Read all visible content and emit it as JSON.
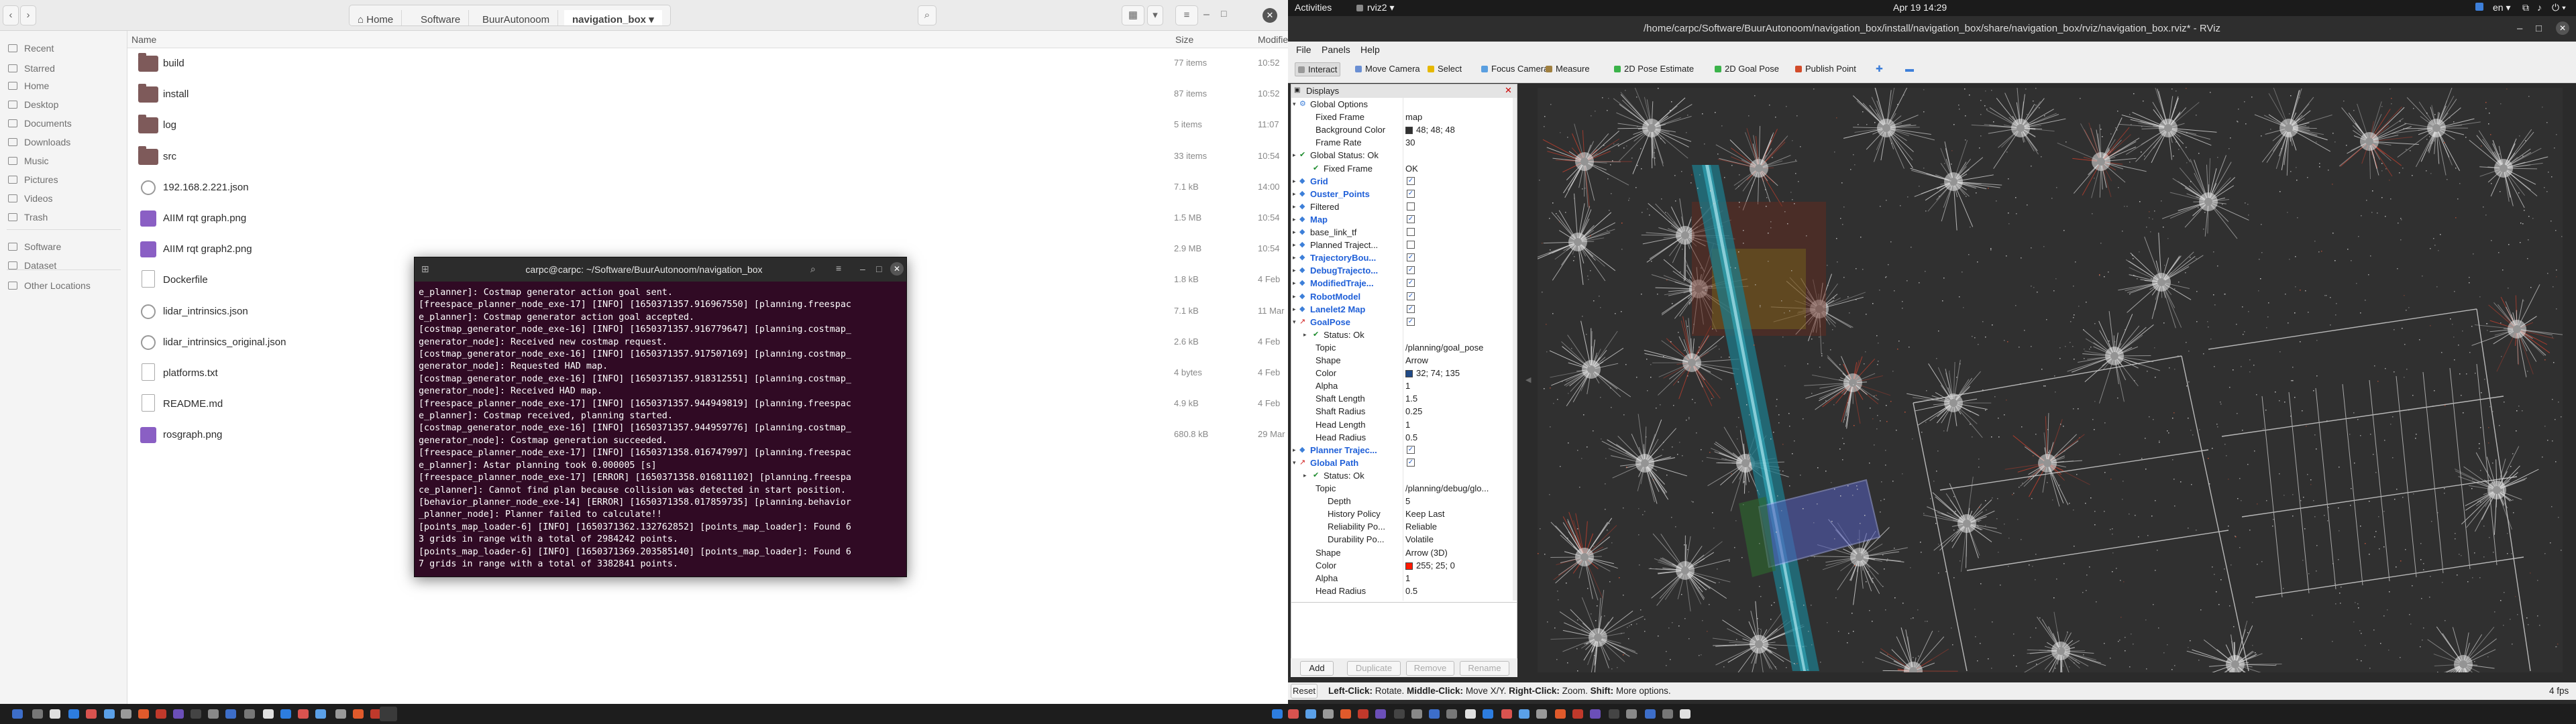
{
  "file_manager": {
    "path": [
      "Home",
      "Software",
      "BuurAutonoom",
      "navigation_box"
    ],
    "columns": {
      "name": "Name",
      "size": "Size",
      "modified": "Modified"
    },
    "sidebar": [
      {
        "label": "Recent",
        "icon": "clock-icon"
      },
      {
        "label": "Starred",
        "icon": "star-icon"
      },
      {
        "label": "Home",
        "icon": "home-icon"
      },
      {
        "label": "Desktop",
        "icon": "folder-icon"
      },
      {
        "label": "Documents",
        "icon": "folder-icon"
      },
      {
        "label": "Downloads",
        "icon": "download-icon"
      },
      {
        "label": "Music",
        "icon": "music-icon"
      },
      {
        "label": "Pictures",
        "icon": "image-icon"
      },
      {
        "label": "Videos",
        "icon": "video-icon"
      },
      {
        "label": "Trash",
        "icon": "trash-icon"
      },
      {
        "label": "Software",
        "icon": "folder-icon"
      },
      {
        "label": "Dataset",
        "icon": "folder-icon"
      },
      {
        "label": "Other Locations",
        "icon": "plus-icon"
      }
    ],
    "files": [
      {
        "name": "build",
        "size": "77 items",
        "modified": "10:52",
        "type": "folder"
      },
      {
        "name": "install",
        "size": "87 items",
        "modified": "10:52",
        "type": "folder"
      },
      {
        "name": "log",
        "size": "5 items",
        "modified": "11:07",
        "type": "folder"
      },
      {
        "name": "src",
        "size": "33 items",
        "modified": "10:54",
        "type": "folder"
      },
      {
        "name": "192.168.2.221.json",
        "size": "7.1 kB",
        "modified": "14:00",
        "type": "json"
      },
      {
        "name": "AIIM rqt graph.png",
        "size": "1.5 MB",
        "modified": "10:54",
        "type": "image"
      },
      {
        "name": "AIIM rqt graph2.png",
        "size": "2.9 MB",
        "modified": "10:54",
        "type": "image"
      },
      {
        "name": "Dockerfile",
        "size": "1.8 kB",
        "modified": "4 Feb",
        "type": "text"
      },
      {
        "name": "lidar_intrinsics.json",
        "size": "7.1 kB",
        "modified": "11 Mar",
        "type": "json"
      },
      {
        "name": "lidar_intrinsics_original.json",
        "size": "2.6 kB",
        "modified": "4 Feb",
        "type": "json"
      },
      {
        "name": "platforms.txt",
        "size": "4 bytes",
        "modified": "4 Feb",
        "type": "text"
      },
      {
        "name": "README.md",
        "size": "4.9 kB",
        "modified": "4 Feb",
        "type": "text"
      },
      {
        "name": "rosgraph.png",
        "size": "680.8 kB",
        "modified": "29 Mar",
        "type": "image"
      }
    ]
  },
  "terminal": {
    "title": "carpc@carpc: ~/Software/BuurAutonoom/navigation_box",
    "lines": [
      "e_planner]: Costmap generator action goal sent.",
      "[freespace_planner_node_exe-17] [INFO] [1650371357.916967550] [planning.freespac",
      "e_planner]: Costmap generator action goal accepted.",
      "[costmap_generator_node_exe-16] [INFO] [1650371357.916779647] [planning.costmap_",
      "generator_node]: Received new costmap request.",
      "[costmap_generator_node_exe-16] [INFO] [1650371357.917507169] [planning.costmap_",
      "generator_node]: Requested HAD map.",
      "[costmap_generator_node_exe-16] [INFO] [1650371357.918312551] [planning.costmap_",
      "generator_node]: Received HAD map.",
      "[freespace_planner_node_exe-17] [INFO] [1650371357.944949819] [planning.freespac",
      "e_planner]: Costmap received, planning started.",
      "[costmap_generator_node_exe-16] [INFO] [1650371357.944959776] [planning.costmap_",
      "generator_node]: Costmap generation succeeded.",
      "[freespace_planner_node_exe-17] [INFO] [1650371358.016747997] [planning.freespac",
      "e_planner]: Astar planning took 0.000005 [s]",
      "[freespace_planner_node_exe-17] [ERROR] [1650371358.016811102] [planning.freespa",
      "ce_planner]: Cannot find plan because collision was detected in start position.",
      "[behavior_planner_node_exe-14] [ERROR] [1650371358.017859735] [planning.behavior",
      "_planner_node]: Planner failed to calculate!!",
      "[points_map_loader-6] [INFO] [1650371362.132762852] [points_map_loader]: Found 6",
      "3 grids in range with a total of 2984242 points.",
      "[points_map_loader-6] [INFO] [1650371369.203585140] [points_map_loader]: Found 6",
      "7 grids in range with a total of 3382841 points."
    ]
  },
  "topbar": {
    "activities": "Activities",
    "app": "rviz2",
    "clock": "Apr 19  14:29"
  },
  "rviz": {
    "title": "/home/carpc/Software/BuurAutonoom/navigation_box/install/navigation_box/share/navigation_box/rviz/navigation_box.rviz* - RViz",
    "menu": [
      "File",
      "Panels",
      "Help"
    ],
    "tools": [
      "Interact",
      "Move Camera",
      "Select",
      "Focus Camera",
      "Measure",
      "2D Pose Estimate",
      "2D Goal Pose",
      "Publish Point"
    ],
    "panel_title": "Displays",
    "tree": [
      {
        "label": "Global Options",
        "indent": 1,
        "kind": "normal"
      },
      {
        "label": "Fixed Frame",
        "indent": 2,
        "value": "map"
      },
      {
        "label": "Background Color",
        "indent": 2,
        "value": "48; 48; 48",
        "swatch": "#303030"
      },
      {
        "label": "Frame Rate",
        "indent": 2,
        "value": "30"
      },
      {
        "label": "Global Status: Ok",
        "indent": 1,
        "check": "ok"
      },
      {
        "label": "Fixed Frame",
        "indent": 2,
        "check": "ok",
        "value": "OK"
      },
      {
        "label": "Grid",
        "indent": 1,
        "kind": "blue",
        "box": true
      },
      {
        "label": "Ouster_Points",
        "indent": 1,
        "kind": "blue",
        "box": true
      },
      {
        "label": "Filtered",
        "indent": 1,
        "box": false
      },
      {
        "label": "Map",
        "indent": 1,
        "kind": "blue",
        "box": true
      },
      {
        "label": "base_link_tf",
        "indent": 1,
        "box": false
      },
      {
        "label": "Planned Traject...",
        "indent": 1,
        "box": false
      },
      {
        "label": "TrajectoryBou...",
        "indent": 1,
        "kind": "blue",
        "box": true
      },
      {
        "label": "DebugTrajecto...",
        "indent": 1,
        "kind": "blue",
        "box": true
      },
      {
        "label": "ModifiedTraje...",
        "indent": 1,
        "kind": "blue",
        "box": true
      },
      {
        "label": "RobotModel",
        "indent": 1,
        "kind": "blue",
        "box": true
      },
      {
        "label": "Lanelet2 Map",
        "indent": 1,
        "kind": "blue",
        "box": true
      },
      {
        "label": "GoalPose",
        "indent": 1,
        "kind": "blue",
        "box": true
      },
      {
        "label": "Status: Ok",
        "indent": 2,
        "check": "ok"
      },
      {
        "label": "Topic",
        "indent": 2,
        "value": "/planning/goal_pose"
      },
      {
        "label": "Shape",
        "indent": 2,
        "value": "Arrow"
      },
      {
        "label": "Color",
        "indent": 2,
        "value": "32; 74; 135",
        "swatch": "#204a87"
      },
      {
        "label": "Alpha",
        "indent": 2,
        "value": "1"
      },
      {
        "label": "Shaft Length",
        "indent": 2,
        "value": "1.5"
      },
      {
        "label": "Shaft Radius",
        "indent": 2,
        "value": "0.25"
      },
      {
        "label": "Head Length",
        "indent": 2,
        "value": "1"
      },
      {
        "label": "Head Radius",
        "indent": 2,
        "value": "0.5"
      },
      {
        "label": "Planner Trajec...",
        "indent": 1,
        "kind": "blue",
        "box": true
      },
      {
        "label": "Global Path",
        "indent": 1,
        "kind": "blue",
        "box": true
      },
      {
        "label": "Status: Ok",
        "indent": 2,
        "check": "ok"
      },
      {
        "label": "Topic",
        "indent": 2,
        "value": "/planning/debug/glo..."
      },
      {
        "label": "Depth",
        "indent": 3,
        "value": "5"
      },
      {
        "label": "History Policy",
        "indent": 3,
        "value": "Keep Last"
      },
      {
        "label": "Reliability Po...",
        "indent": 3,
        "value": "Reliable"
      },
      {
        "label": "Durability Po...",
        "indent": 3,
        "value": "Volatile"
      },
      {
        "label": "Shape",
        "indent": 2,
        "value": "Arrow (3D)"
      },
      {
        "label": "Color",
        "indent": 2,
        "value": "255; 25; 0",
        "swatch": "#ff1900"
      },
      {
        "label": "Alpha",
        "indent": 2,
        "value": "1"
      },
      {
        "label": "Head Radius",
        "indent": 2,
        "value": "0.5"
      }
    ],
    "buttons": {
      "add": "Add",
      "duplicate": "Duplicate",
      "remove": "Remove",
      "rename": "Rename"
    },
    "status": {
      "reset": "Reset",
      "hint_bold": "Left-Click:",
      "hint1": " Rotate. ",
      "hint_bold2": "Middle-Click:",
      "hint2": " Move X/Y. ",
      "hint_bold3": "Right-Click:",
      "hint3": " Zoom. ",
      "hint_bold4": "Shift:",
      "hint4": " More options.",
      "fps": "4 fps"
    }
  }
}
